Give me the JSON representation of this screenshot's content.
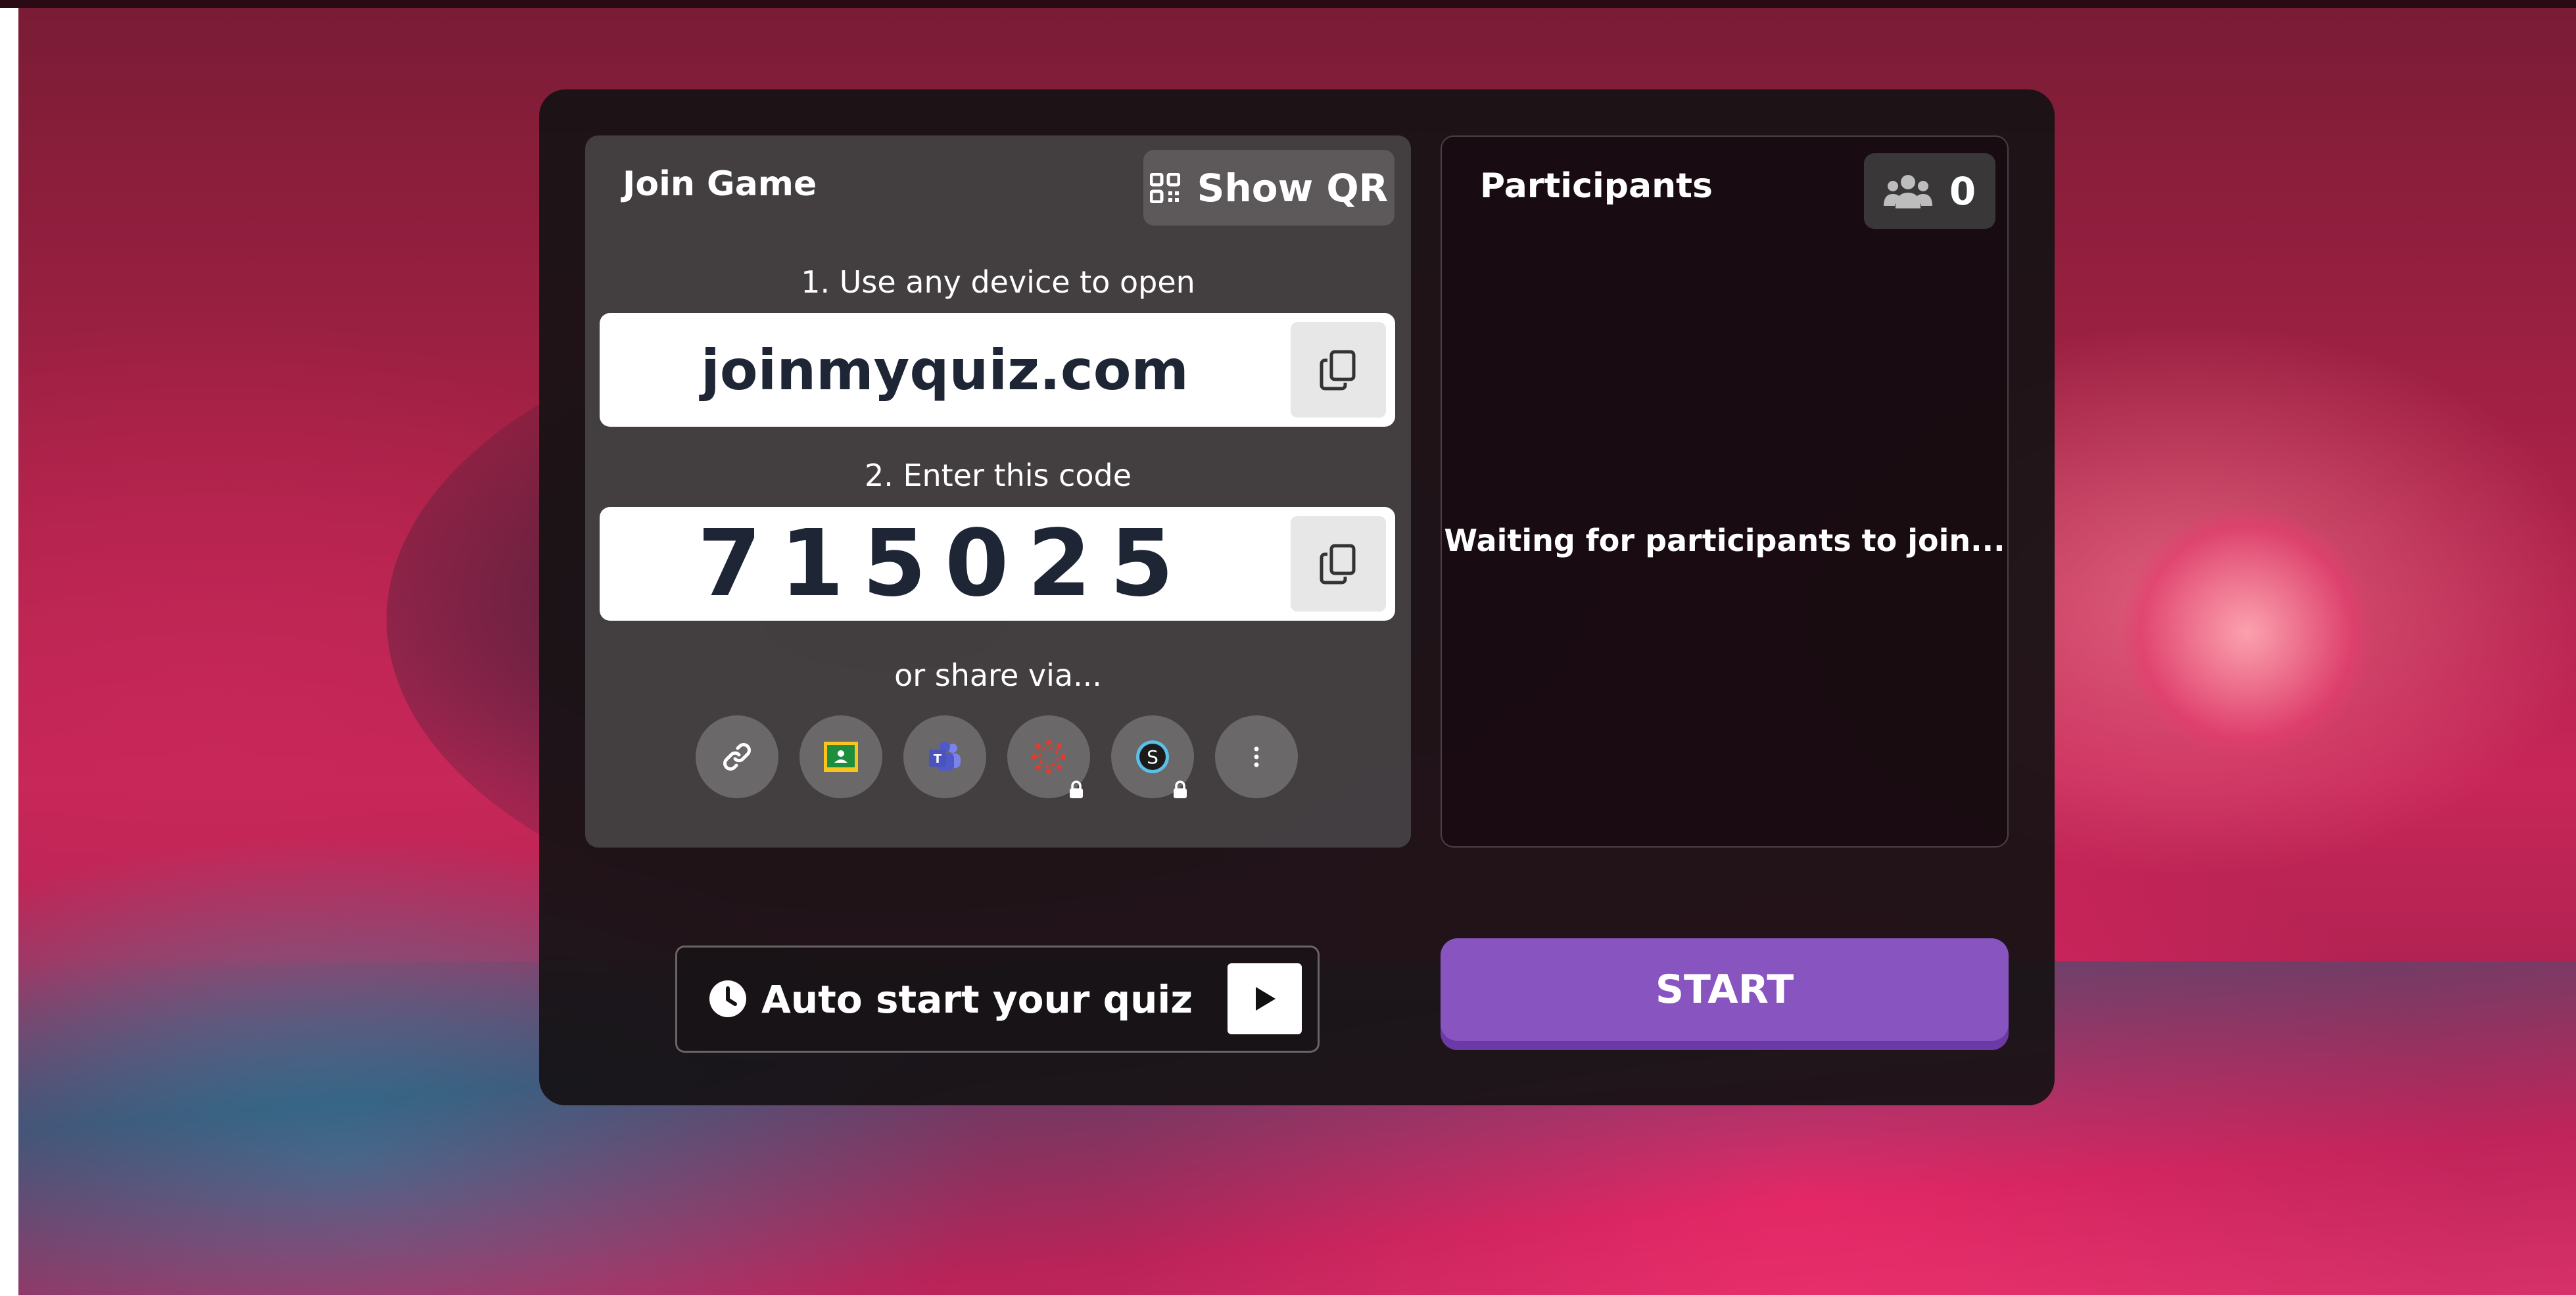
{
  "join": {
    "title": "Join Game",
    "show_qr_label": "Show QR",
    "step1": "1. Use any device to open",
    "url": "joinmyquiz.com",
    "step2": "2. Enter this code",
    "code": "715025",
    "share_label": "or share via...",
    "share_options": [
      {
        "icon": "link-icon",
        "locked": false
      },
      {
        "icon": "google-classroom-icon",
        "locked": false
      },
      {
        "icon": "microsoft-teams-icon",
        "locked": false
      },
      {
        "icon": "canvas-icon",
        "locked": true
      },
      {
        "icon": "schoology-icon",
        "locked": true
      },
      {
        "icon": "more-icon",
        "locked": false
      }
    ]
  },
  "participants": {
    "title": "Participants",
    "count": "0",
    "waiting_text": "Waiting for participants to join..."
  },
  "footer": {
    "autostart_label": "Auto start your quiz",
    "start_label": "START"
  },
  "colors": {
    "accent": "#8854c0",
    "code_text": "#1e2636"
  }
}
